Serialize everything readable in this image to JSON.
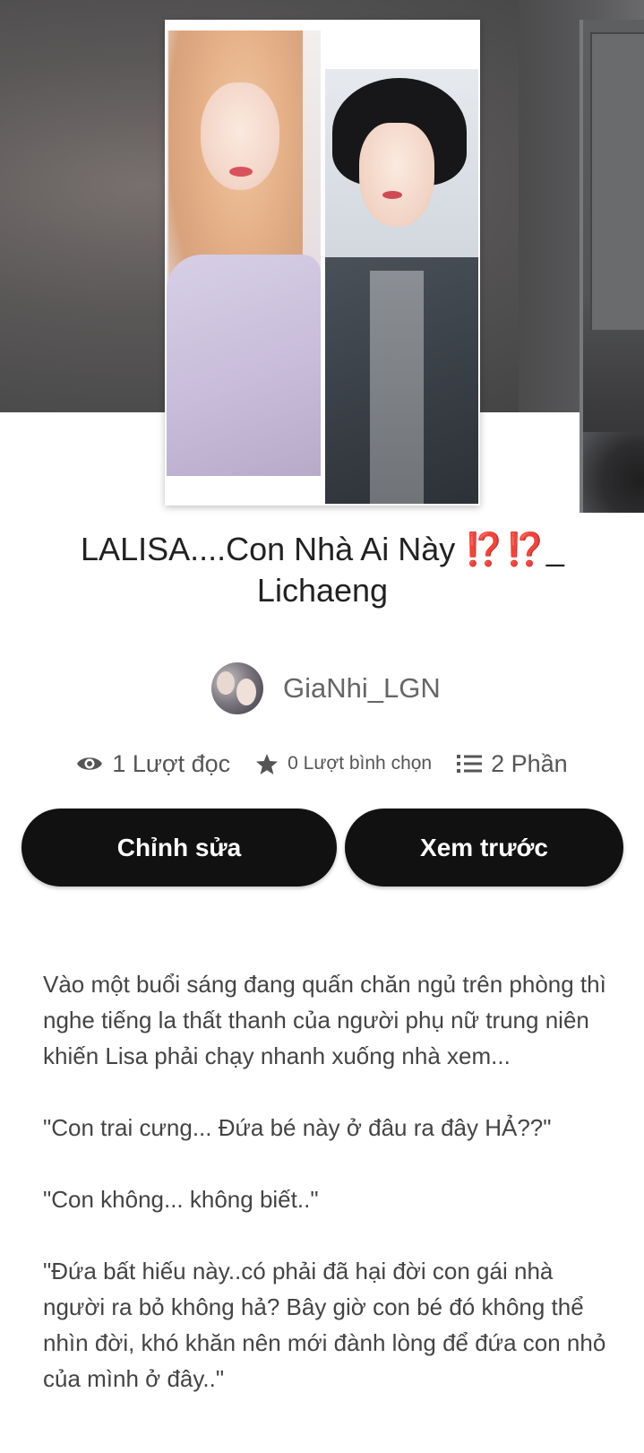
{
  "story": {
    "title_text": "LALISA....Con Nhà Ai Này ",
    "title_marks": "⁉️⁉️",
    "title_suffix": "_ Lichaeng",
    "author": "GiaNhi_LGN"
  },
  "stats": {
    "reads": "1 Lượt đọc",
    "votes": "0 Lượt bình chọn",
    "parts": "2 Phần"
  },
  "actions": {
    "edit_label": "Chỉnh sửa",
    "preview_label": "Xem trước"
  },
  "description": [
    "Vào một buổi sáng đang quấn chăn ngủ trên phòng thì nghe tiếng la thất thanh của người phụ nữ trung niên khiến Lisa phải chạy nhanh xuống nhà xem...",
    "\"Con trai cưng... Đứa bé này ở đâu ra đây  HẢ??\"",
    "\"Con không... không biết..\"",
    "\"Đứa bất hiếu này..có phải đã hại đời con gái nhà người ra bỏ không hả? Bây giờ con bé đó không thể nhìn đời, khó khăn nên mới đành lòng để đứa con nhỏ của mình ở đây..\""
  ],
  "icons": {
    "reads": "eye-icon",
    "votes": "star-icon",
    "parts": "list-icon"
  },
  "colors": {
    "button_bg": "#111111",
    "button_text": "#ffffff",
    "title_marks": "#d5252f"
  }
}
